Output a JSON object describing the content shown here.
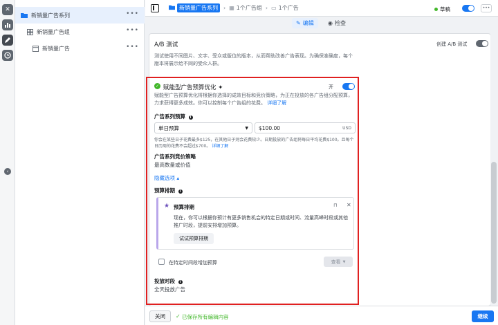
{
  "tree": {
    "campaign": "新销量广告系列",
    "adset": "新销量广告组",
    "ad": "新销量广告"
  },
  "topbar": {
    "campaign": "新销量广告系列",
    "adset": "1个广告组",
    "ad": "1个广告",
    "status": "草稿"
  },
  "tabs": {
    "edit": "编辑",
    "review": "检查"
  },
  "ab": {
    "title": "A/B 测试",
    "toggle_label": "创建 A/B 测试",
    "desc": "测试使用不同图片、文字、受众或版位的版本，从而帮助改善广告表现。为确保准确度，每个版本将展示给不同的受众人群。"
  },
  "cbo": {
    "title": "赋能型广告预算优化 ✦",
    "switch_label": "开",
    "desc": "赋能型广告预算优化将根据你选择的成效目标和竞价策略，为正在投放的各广告组分配预算，力求获得更多成效。你可以控制每个广告组的花费。",
    "learn_more": "详细了解",
    "budget_label": "广告系列预算",
    "budget_type": "单日预算",
    "budget_value": "$100.00",
    "currency": "USD",
    "budget_note": "你会在某些日子花费最多$125，在其他日子则会花费较少。日期投放的广告组将每日平均花费$100。且每个日历周的花费不会超过$700。",
    "budget_note_link": "详细了解",
    "bid_label": "广告系列竞价策略",
    "bid_value": "最高数量或价值",
    "hide_options": "隐藏选项 ▴",
    "schedule_label": "预算排期",
    "schedule_card_title": "预算排期",
    "schedule_card_desc": "现在，你可以根据你预计有更多销售机会的特定日期或时间、流量高峰时段或其他推广时段，提前安排增加预算。",
    "schedule_try": "试试预算排期",
    "schedule_checkbox": "在特定时间段增加预算",
    "view": "查看",
    "delivery_label": "投放时段",
    "delivery_value": "全天投放广告"
  },
  "footer": {
    "close": "关闭",
    "saved": "已保存所有编辑内容",
    "continue": "继续"
  },
  "colors": {
    "accent": "#1877f2",
    "success": "#42b72a",
    "highlight": "#e02020"
  }
}
